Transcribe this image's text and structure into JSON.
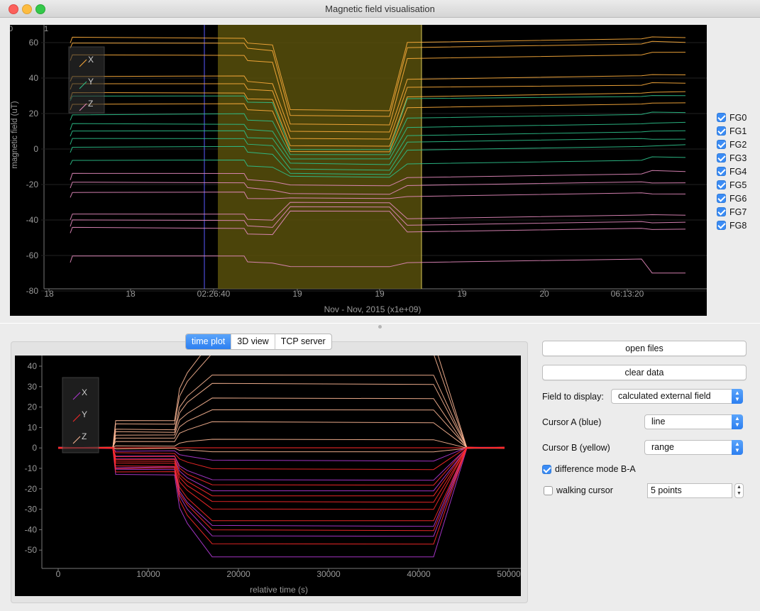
{
  "window": {
    "title": "Magnetic field visualisation"
  },
  "top_plot": {
    "ylabel": "magnetic field (uT)",
    "xlabel": "Nov - Nov, 2015 (x1e+09)",
    "y_ticks": [
      "60",
      "40",
      "20",
      "0",
      "-20",
      "-40",
      "-60",
      "-80"
    ],
    "x_ticks": [
      "18",
      "18",
      "02:26:40",
      "19",
      "19",
      "19",
      "20",
      "06:13:20"
    ],
    "corner_labels": [
      "0",
      "1"
    ],
    "legend": [
      "X",
      "Y",
      "Z"
    ],
    "colors": {
      "X": "#ffae3c",
      "Y": "#2ec28c",
      "Z": "#e68bbf",
      "cursor_a": "#5a5aff",
      "cursor_b_range": "#58500c"
    }
  },
  "fg_list": [
    {
      "label": "FG0",
      "checked": true
    },
    {
      "label": "FG1",
      "checked": true
    },
    {
      "label": "FG2",
      "checked": true
    },
    {
      "label": "FG3",
      "checked": true
    },
    {
      "label": "FG4",
      "checked": true
    },
    {
      "label": "FG5",
      "checked": true
    },
    {
      "label": "FG6",
      "checked": true
    },
    {
      "label": "FG7",
      "checked": true
    },
    {
      "label": "FG8",
      "checked": true
    }
  ],
  "tabs": [
    {
      "label": "time plot",
      "active": true
    },
    {
      "label": "3D view",
      "active": false
    },
    {
      "label": "TCP server",
      "active": false
    }
  ],
  "bottom_plot": {
    "xlabel": "relative time (s)",
    "y_ticks": [
      "40",
      "30",
      "20",
      "10",
      "0",
      "-10",
      "-20",
      "-30",
      "-40",
      "-50"
    ],
    "x_ticks": [
      "0",
      "10000",
      "20000",
      "30000",
      "40000",
      "50000"
    ],
    "legend": [
      "X",
      "Y",
      "Z"
    ],
    "colors": {
      "X": "#b23ad6",
      "Y": "#ff2a2a",
      "Z": "#ffb896"
    }
  },
  "controls": {
    "open_files": "open files",
    "clear_data": "clear data",
    "field_label": "Field to display:",
    "field_value": "calculated external field",
    "cursor_a_label": "Cursor A (blue)",
    "cursor_a_value": "line",
    "cursor_b_label": "Cursor B (yellow)",
    "cursor_b_value": "range",
    "difference_label": "difference mode B-A",
    "difference_checked": true,
    "walking_label": "walking cursor",
    "walking_checked": false,
    "points_value": "5 points"
  }
}
